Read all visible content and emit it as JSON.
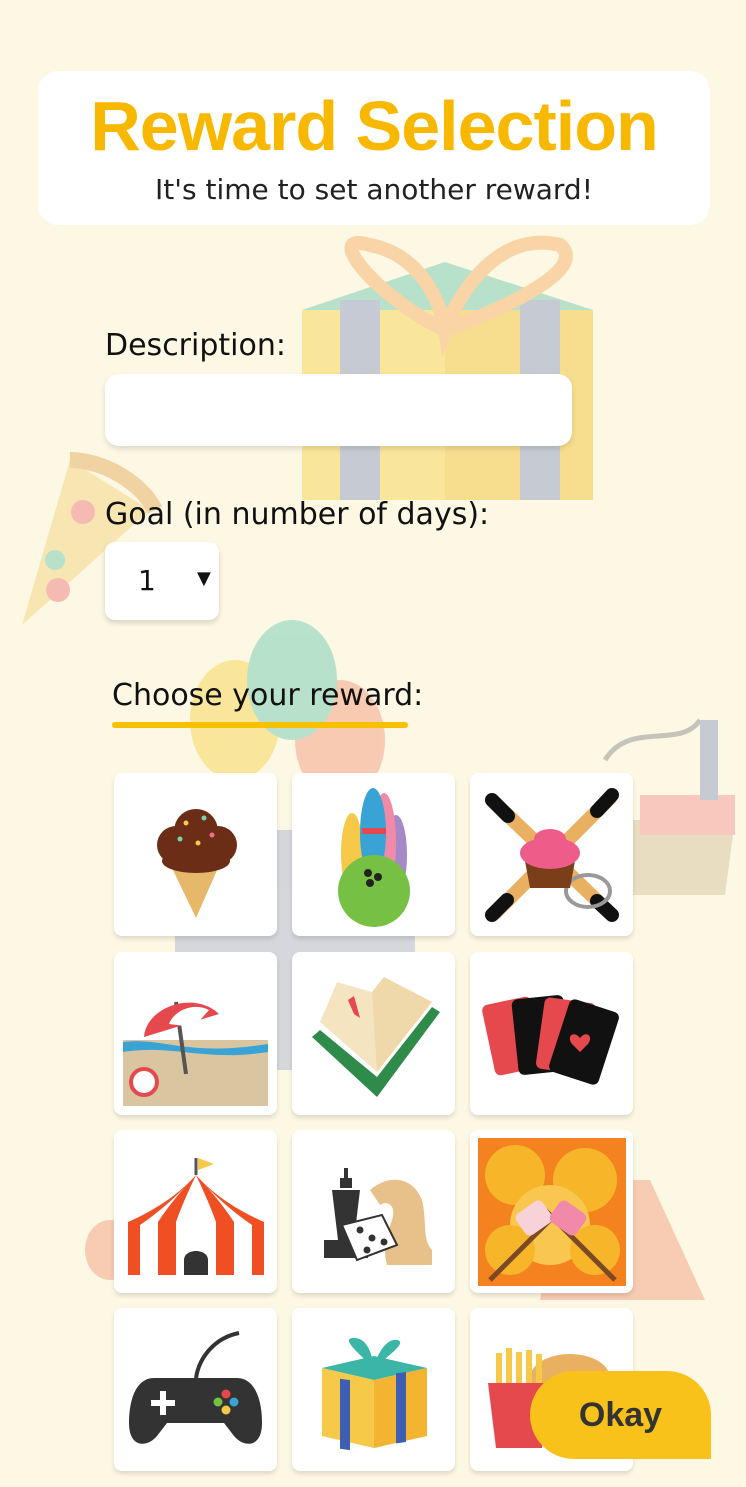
{
  "header": {
    "title": "Reward Selection",
    "subtitle": "It's time to set another reward!"
  },
  "form": {
    "description_label": "Description:",
    "description_value": "",
    "goal_label": "Goal (in number of days):",
    "goal_value": "1"
  },
  "rewards": {
    "heading": "Choose your reward:",
    "items": [
      {
        "icon": "ice-cream-icon"
      },
      {
        "icon": "bowling-icon"
      },
      {
        "icon": "baking-icon"
      },
      {
        "icon": "beach-icon"
      },
      {
        "icon": "book-icon"
      },
      {
        "icon": "playing-cards-icon"
      },
      {
        "icon": "circus-tent-icon"
      },
      {
        "icon": "board-games-icon"
      },
      {
        "icon": "campfire-marshmallow-icon"
      },
      {
        "icon": "game-controller-icon"
      },
      {
        "icon": "gift-icon"
      },
      {
        "icon": "fast-food-icon"
      }
    ]
  },
  "okay_button": "Okay",
  "colors": {
    "background": "#fdf8e4",
    "accent": "#f9b800",
    "button": "#f9c21a"
  }
}
